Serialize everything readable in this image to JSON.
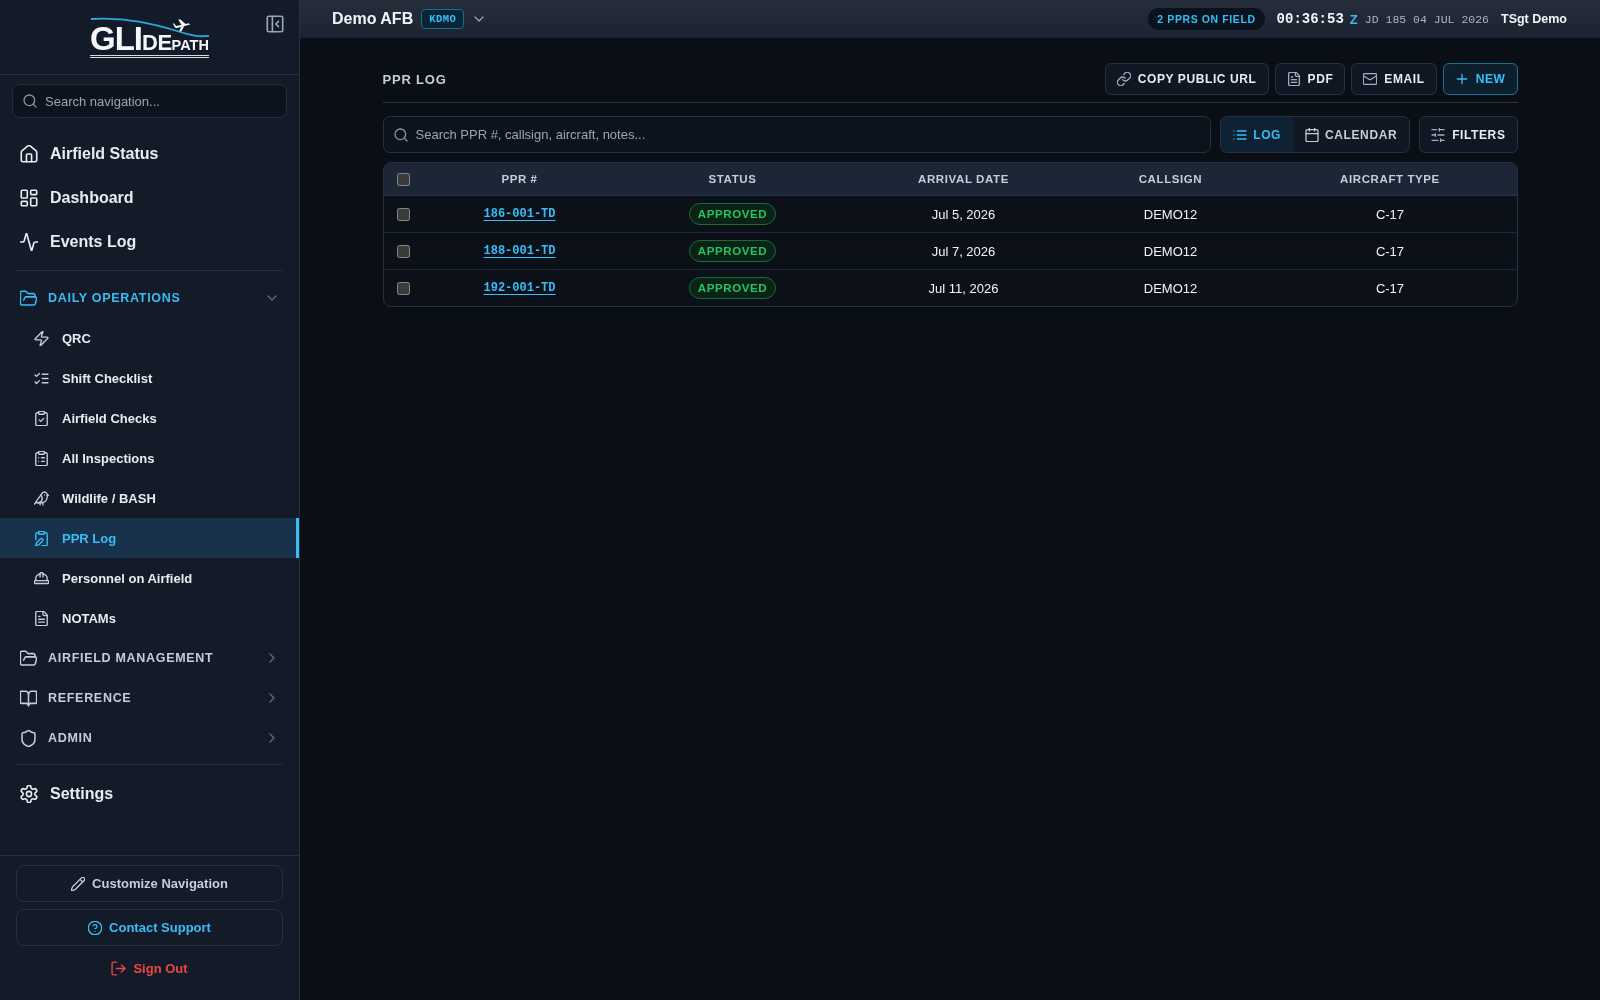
{
  "sidebar": {
    "logo": {
      "text": "GLIDEPATH"
    },
    "search": {
      "placeholder": "Search navigation..."
    },
    "top_links": [
      {
        "label": "Airfield Status",
        "selected": false
      },
      {
        "label": "Dashboard",
        "selected": false
      },
      {
        "label": "Events Log",
        "selected": false
      }
    ],
    "sections": [
      {
        "title": "DAILY OPERATIONS",
        "expanded": true,
        "items": [
          {
            "label": "QRC",
            "selected": false
          },
          {
            "label": "Shift Checklist",
            "selected": false
          },
          {
            "label": "Airfield Checks",
            "selected": false
          },
          {
            "label": "All Inspections",
            "selected": false
          },
          {
            "label": "Wildlife / BASH",
            "selected": false
          },
          {
            "label": "PPR Log",
            "selected": true
          },
          {
            "label": "Personnel on Airfield",
            "selected": false
          },
          {
            "label": "NOTAMs",
            "selected": false
          }
        ]
      },
      {
        "title": "AIRFIELD MANAGEMENT",
        "expanded": false
      },
      {
        "title": "REFERENCE",
        "expanded": false
      },
      {
        "title": "ADMIN",
        "expanded": false
      }
    ],
    "bottom_links": [
      {
        "label": "Settings",
        "selected": false
      }
    ],
    "footer": [
      {
        "kind": "outline",
        "label": "Customize Navigation"
      },
      {
        "kind": "support",
        "label": "Contact Support"
      },
      {
        "kind": "danger",
        "label": "Sign Out"
      }
    ]
  },
  "topbar": {
    "base": "Demo AFB",
    "airfield_code": "KDMO",
    "status_pill": "2 PPRS ON FIELD",
    "clock": {
      "time": "00:36:53",
      "zone": "Z",
      "date": "JD 185 04 JUL 2026"
    },
    "user": "TSgt Demo"
  },
  "page": {
    "title": "PPR LOG",
    "actions": [
      {
        "kind": "default",
        "label": "COPY PUBLIC URL"
      },
      {
        "kind": "default",
        "label": "PDF"
      },
      {
        "kind": "default",
        "label": "EMAIL"
      },
      {
        "kind": "primary",
        "label": "NEW"
      }
    ],
    "search": {
      "placeholder": "Search PPR #, callsign, aircraft, notes..."
    },
    "views": [
      {
        "label": "LOG",
        "selected": true
      },
      {
        "label": "CALENDAR",
        "selected": false
      }
    ],
    "filters": {
      "label": "FILTERS"
    },
    "table": {
      "select_all": {
        "checked": false
      },
      "columns": [
        "PPR #",
        "STATUS",
        "ARRIVAL DATE",
        "CALLSIGN",
        "AIRCRAFT TYPE"
      ],
      "rows": [
        {
          "checked": false,
          "ppr": "186-001-TD",
          "status": "APPROVED",
          "arrival_date": "Jul 5, 2026",
          "callsign": "DEMO12",
          "aircraft_type": "C-17"
        },
        {
          "checked": false,
          "ppr": "188-001-TD",
          "status": "APPROVED",
          "arrival_date": "Jul 7, 2026",
          "callsign": "DEMO12",
          "aircraft_type": "C-17"
        },
        {
          "checked": false,
          "ppr": "192-001-TD",
          "status": "APPROVED",
          "arrival_date": "Jul 11, 2026",
          "callsign": "DEMO12",
          "aircraft_type": "C-17"
        }
      ]
    }
  }
}
